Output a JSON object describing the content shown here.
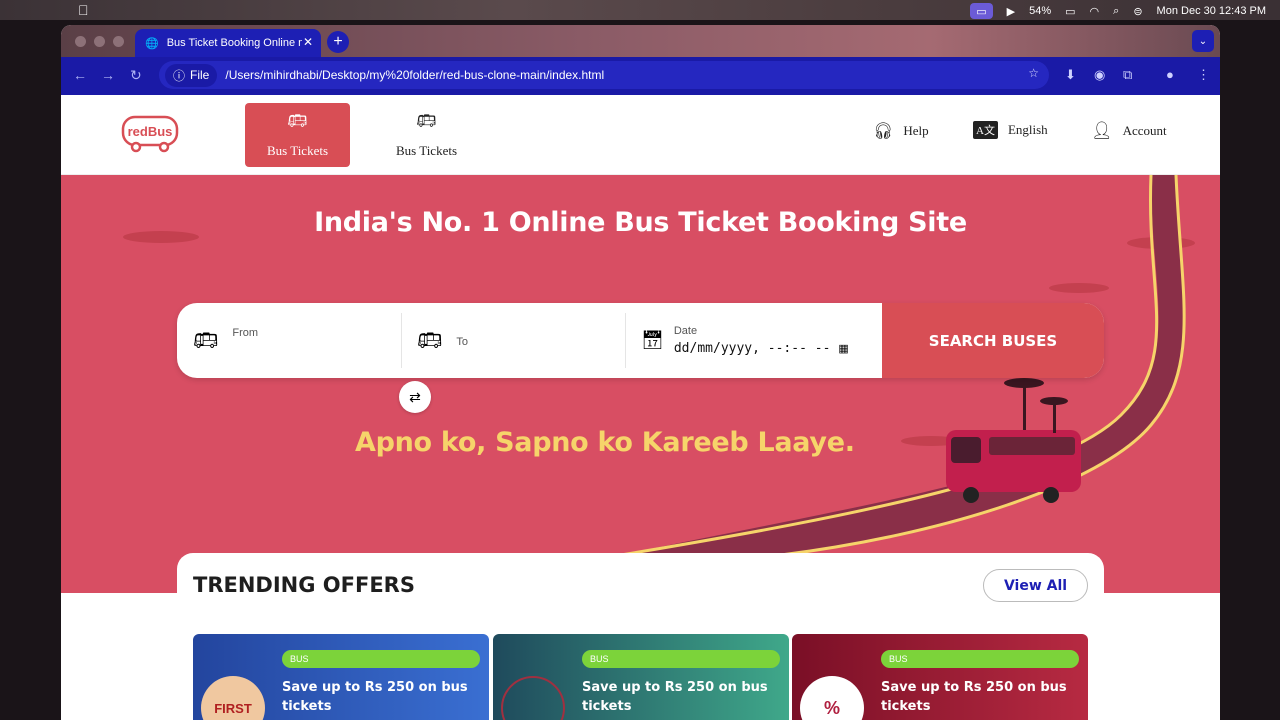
{
  "os_menubar": {
    "battery": "54%",
    "clock": "Mon Dec 30  12:43 PM"
  },
  "browser": {
    "tab_title": "Bus Ticket Booking Online m",
    "omnibox_chip": "File",
    "url": "/Users/mihirdhabi/Desktop/my%20folder/red-bus-clone-main/index.html"
  },
  "site": {
    "logo_text": "redBus",
    "nav_tabs": [
      {
        "label": "Bus Tickets"
      },
      {
        "label": "Bus Tickets"
      }
    ],
    "header_links": {
      "help": "Help",
      "language": "English",
      "account": "Account"
    }
  },
  "hero": {
    "headline": "India's No. 1 Online Bus Ticket Booking Site",
    "tagline": "Apno ko, Sapno ko Kareeb Laaye.",
    "search": {
      "from_label": "From",
      "to_label": "To",
      "date_label": "Date",
      "date_placeholder": "dd/mm/yyyy, --:-- --",
      "button_label": "SEARCH BUSES"
    }
  },
  "offers": {
    "title": "TRENDING OFFERS",
    "view_all": "View All",
    "cards": [
      {
        "badge": "BUS",
        "text": "Save up to Rs 250 on bus tickets",
        "img_text": "FIRST"
      },
      {
        "badge": "BUS",
        "text": "Save up to Rs 250 on bus tickets",
        "img_text": ""
      },
      {
        "badge": "BUS",
        "text": "Save up to Rs 250 on bus tickets",
        "img_text": "%"
      }
    ]
  },
  "colors": {
    "brand": "#d84e55",
    "hero_bg": "#d84e63",
    "tagline": "#f6d46a",
    "browser_accent": "#1d1fb4"
  }
}
